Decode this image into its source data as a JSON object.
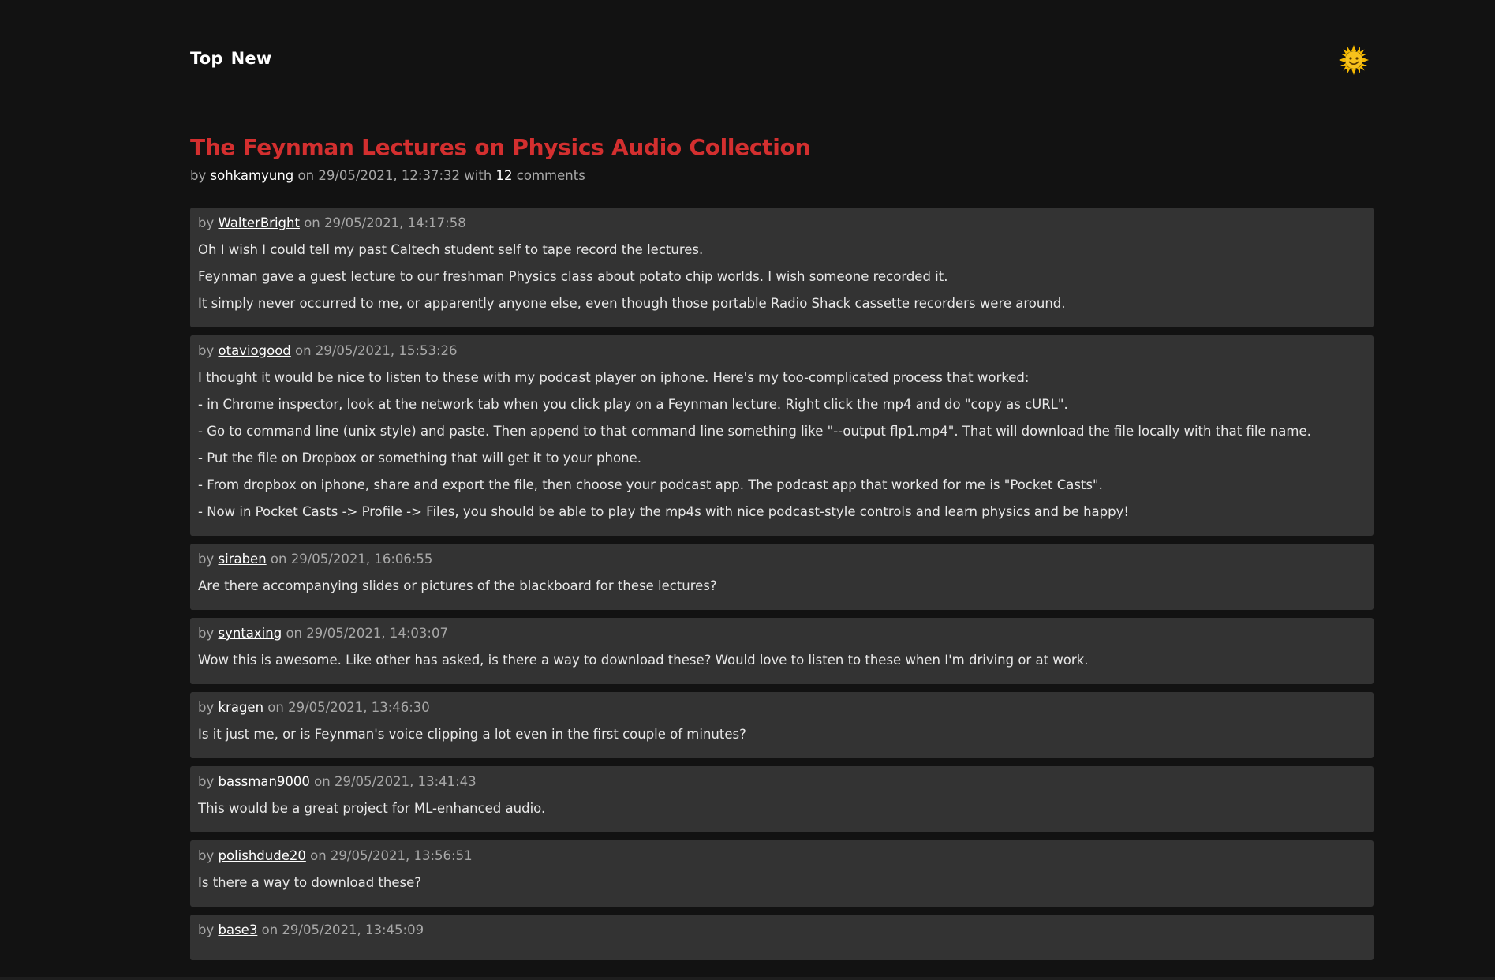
{
  "nav": {
    "items": [
      {
        "label": "Top"
      },
      {
        "label": "New"
      }
    ],
    "theme_icon": "sun-face-icon"
  },
  "story": {
    "title": "The Feynman Lectures on Physics Audio Collection",
    "by_prefix": "by",
    "author": "sohkamyung",
    "on_prefix": "on",
    "timestamp": "29/05/2021, 12:37:32",
    "with_prefix": "with",
    "comment_count": "12",
    "comments_suffix": "comments"
  },
  "comments": [
    {
      "author": "WalterBright",
      "timestamp": "29/05/2021, 14:17:58",
      "paragraphs": [
        "Oh I wish I could tell my past Caltech student self to tape record the lectures.",
        "Feynman gave a guest lecture to our freshman Physics class about potato chip worlds. I wish someone recorded it.",
        "It simply never occurred to me, or apparently anyone else, even though those portable Radio Shack cassette recorders were around."
      ]
    },
    {
      "author": "otaviogood",
      "timestamp": "29/05/2021, 15:53:26",
      "paragraphs": [
        "I thought it would be nice to listen to these with my podcast player on iphone. Here's my too-complicated process that worked:",
        "- in Chrome inspector, look at the network tab when you click play on a Feynman lecture. Right click the mp4 and do \"copy as cURL\".",
        "- Go to command line (unix style) and paste. Then append to that command line something like \"--output flp1.mp4\". That will download the file locally with that file name.",
        "- Put the file on Dropbox or something that will get it to your phone.",
        "- From dropbox on iphone, share and export the file, then choose your podcast app. The podcast app that worked for me is \"Pocket Casts\".",
        "- Now in Pocket Casts -> Profile -> Files, you should be able to play the mp4s with nice podcast-style controls and learn physics and be happy!"
      ]
    },
    {
      "author": "siraben",
      "timestamp": "29/05/2021, 16:06:55",
      "paragraphs": [
        "Are there accompanying slides or pictures of the blackboard for these lectures?"
      ]
    },
    {
      "author": "syntaxing",
      "timestamp": "29/05/2021, 14:03:07",
      "paragraphs": [
        "Wow this is awesome. Like other has asked, is there a way to download these? Would love to listen to these when I'm driving or at work."
      ]
    },
    {
      "author": "kragen",
      "timestamp": "29/05/2021, 13:46:30",
      "paragraphs": [
        "Is it just me, or is Feynman's voice clipping a lot even in the first couple of minutes?"
      ]
    },
    {
      "author": "bassman9000",
      "timestamp": "29/05/2021, 13:41:43",
      "paragraphs": [
        "This would be a great project for ML-enhanced audio."
      ]
    },
    {
      "author": "polishdude20",
      "timestamp": "29/05/2021, 13:56:51",
      "paragraphs": [
        "Is there a way to download these?"
      ]
    },
    {
      "author": "base3",
      "timestamp": "29/05/2021, 13:45:09",
      "paragraphs": []
    }
  ],
  "labels": {
    "by": "by",
    "on": "on"
  },
  "colors": {
    "background": "#121212",
    "card": "#333333",
    "title": "#d32f2f",
    "meta": "#a8a8a8",
    "text": "#e8e8e8",
    "sun": "#f5b800"
  }
}
